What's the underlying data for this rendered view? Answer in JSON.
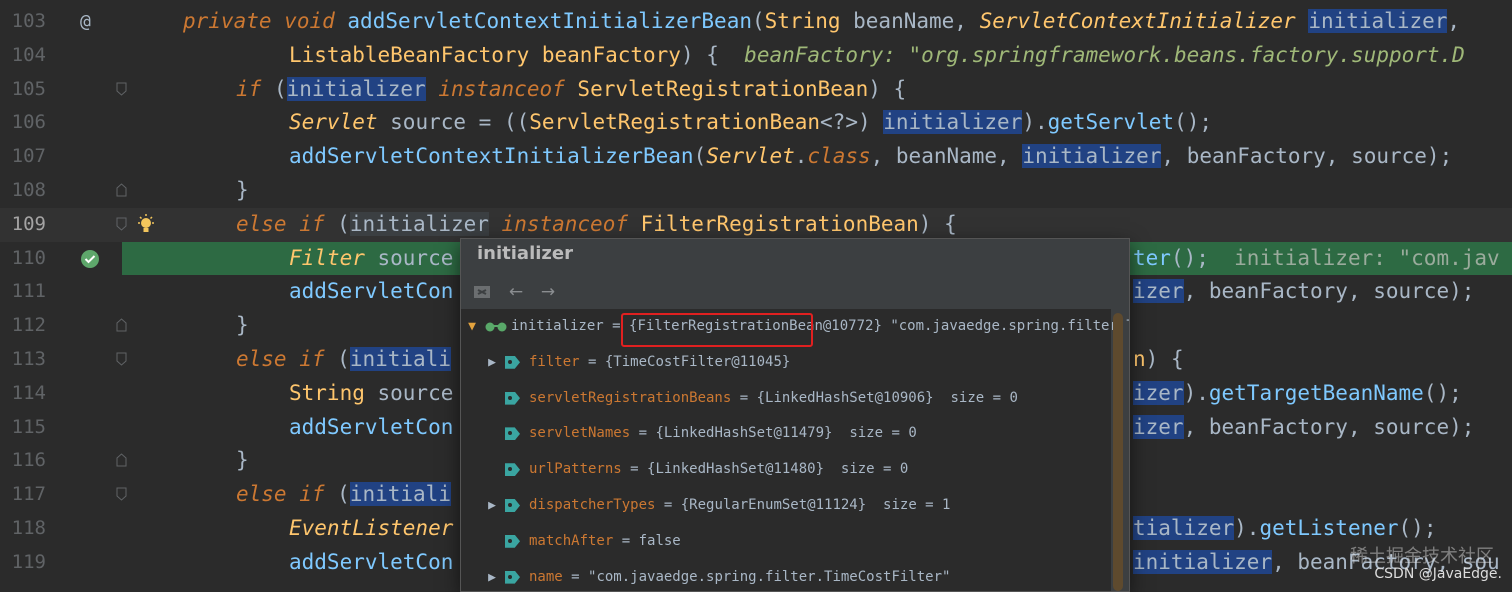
{
  "editor": {
    "lines": [
      {
        "num": "103"
      },
      {
        "num": "104"
      },
      {
        "num": "105"
      },
      {
        "num": "106"
      },
      {
        "num": "107"
      },
      {
        "num": "108"
      },
      {
        "num": "109"
      },
      {
        "num": "110"
      },
      {
        "num": "111"
      },
      {
        "num": "112"
      },
      {
        "num": "113"
      },
      {
        "num": "114"
      },
      {
        "num": "115"
      },
      {
        "num": "116"
      },
      {
        "num": "117"
      },
      {
        "num": "118"
      },
      {
        "num": "119"
      }
    ],
    "override_marker": "@",
    "hint_104": "beanFactory: \"org.springframework.beans.factory.support.D",
    "hint_110": "initializer: \"com.jav"
  },
  "popup": {
    "title": "initializer",
    "root": {
      "name": "initializer",
      "ref": "{FilterRegistrationBean@10772}",
      "value": "\"com.javaedge.spring.filter.Ti"
    },
    "fields": [
      {
        "name": "filter",
        "value": "= {TimeCostFilter@11045}",
        "size": "",
        "expandable": true
      },
      {
        "name": "servletRegistrationBeans",
        "value": "= {LinkedHashSet@10906}",
        "size": "size = 0",
        "expandable": false
      },
      {
        "name": "servletNames",
        "value": "= {LinkedHashSet@11479}",
        "size": "size = 0",
        "expandable": false
      },
      {
        "name": "urlPatterns",
        "value": "= {LinkedHashSet@11480}",
        "size": "size = 0",
        "expandable": false
      },
      {
        "name": "dispatcherTypes",
        "value": "= {RegularEnumSet@11124}",
        "size": "size = 1",
        "expandable": true
      },
      {
        "name": "matchAfter",
        "value": "= false",
        "size": "",
        "expandable": false
      },
      {
        "name": "name",
        "value": "= \"com.javaedge.spring.filter.TimeCostFilter\"",
        "size": "",
        "expandable": true
      }
    ]
  },
  "watermark": "CSDN @JavaEdge.",
  "watermark_faint": "稀土掘金技术社区",
  "colors": {
    "editor_bg": "#2b2b2b",
    "exec_line": "#2d6a43",
    "keyword": "#cc7832",
    "type": "#ffc66d",
    "method": "#7fc9ff",
    "selection": "#214283"
  }
}
